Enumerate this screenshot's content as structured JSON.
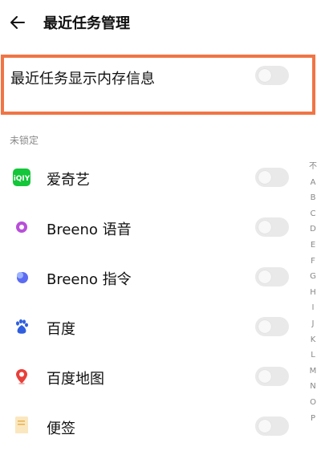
{
  "header": {
    "title": "最近任务管理",
    "back_icon": "arrow-left-icon"
  },
  "memory_setting": {
    "label": "最近任务显示内存信息",
    "enabled": false
  },
  "section": {
    "label": "未锁定"
  },
  "apps": [
    {
      "name": "爱奇艺",
      "icon": "iqiyi-icon",
      "locked": false
    },
    {
      "name": "Breeno 语音",
      "icon": "breeno-voice-icon",
      "locked": false
    },
    {
      "name": "Breeno 指令",
      "icon": "breeno-command-icon",
      "locked": false
    },
    {
      "name": "百度",
      "icon": "baidu-icon",
      "locked": false
    },
    {
      "name": "百度地图",
      "icon": "baidu-map-icon",
      "locked": false
    },
    {
      "name": "便签",
      "icon": "notes-icon",
      "locked": false
    }
  ],
  "index_letters": [
    "不",
    "A",
    "B",
    "C",
    "D",
    "E",
    "F",
    "G",
    "H",
    "I",
    "J",
    "K",
    "L",
    "M",
    "N",
    "O",
    "P"
  ],
  "colors": {
    "highlight_border": "#f07545",
    "toggle_off": "#e9e9e9"
  }
}
